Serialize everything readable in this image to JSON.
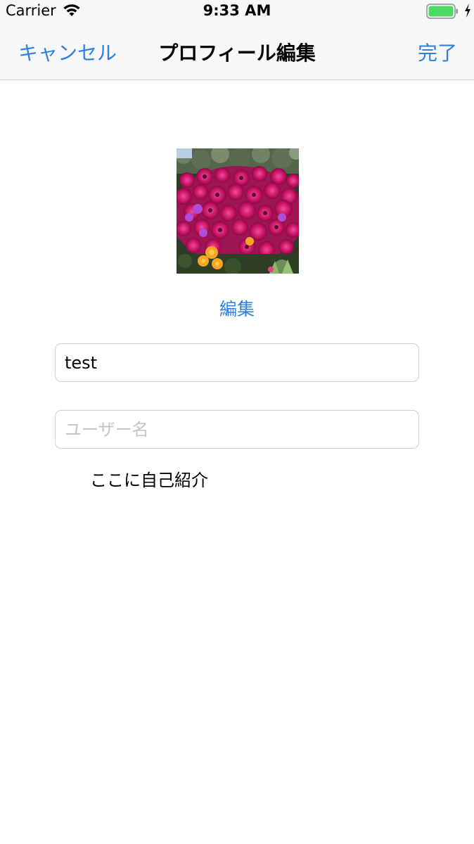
{
  "status_bar": {
    "carrier": "Carrier",
    "time": "9:33 AM",
    "wifi_icon": "wifi-icon",
    "battery_icon": "battery-full-icon",
    "charging_icon": "charging-bolt-icon",
    "battery_color": "#4cd964"
  },
  "nav": {
    "cancel_label": "キャンセル",
    "title": "プロフィール編集",
    "done_label": "完了"
  },
  "profile": {
    "avatar_icon": "profile-photo-flowers",
    "edit_photo_label": "編集"
  },
  "form": {
    "name_value": "test",
    "username_placeholder": "ユーザー名",
    "username_value": "",
    "bio_value": "ここに自己紹介"
  },
  "colors": {
    "accent": "#2f7fe5",
    "bar_background": "#f7f7f7",
    "field_border": "#cfcfd3"
  }
}
